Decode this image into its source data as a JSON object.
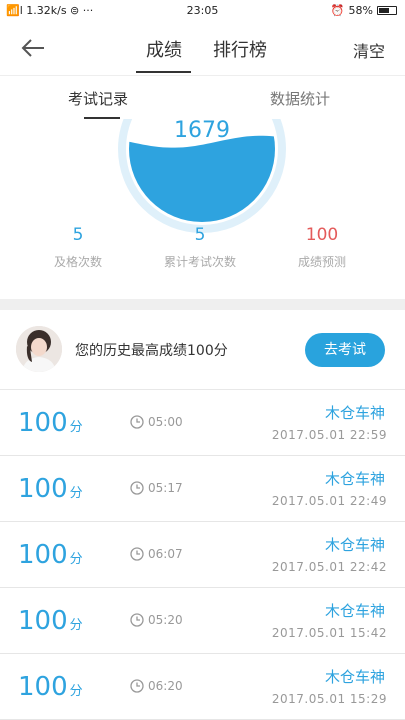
{
  "status_bar": {
    "signal": "📶l 1.32k/s ⊜ ···",
    "time": "23:05",
    "battery": "58%"
  },
  "nav": {
    "tabs": [
      "成绩",
      "排行榜"
    ],
    "clear_label": "清空"
  },
  "sub_tabs": [
    "考试记录",
    "数据统计"
  ],
  "gauge": {
    "value": "1679",
    "fill_level": 0.55,
    "accent": "#2ea3df"
  },
  "stats": [
    {
      "value": "5",
      "label": "及格次数"
    },
    {
      "value": "5",
      "label": "累计考试次数"
    },
    {
      "value": "100",
      "label": "成绩预测"
    }
  ],
  "best": {
    "text": "您的历史最高成绩100分",
    "button_label": "去考试"
  },
  "records": [
    {
      "score": "100",
      "unit": "分",
      "duration": "05:00",
      "name": "木仓车神",
      "date": "2017.05.01  22:59"
    },
    {
      "score": "100",
      "unit": "分",
      "duration": "05:17",
      "name": "木仓车神",
      "date": "2017.05.01  22:49"
    },
    {
      "score": "100",
      "unit": "分",
      "duration": "06:07",
      "name": "木仓车神",
      "date": "2017.05.01  22:42"
    },
    {
      "score": "100",
      "unit": "分",
      "duration": "05:20",
      "name": "木仓车神",
      "date": "2017.05.01  15:42"
    },
    {
      "score": "100",
      "unit": "分",
      "duration": "06:20",
      "name": "木仓车神",
      "date": "2017.05.01  15:29"
    }
  ]
}
